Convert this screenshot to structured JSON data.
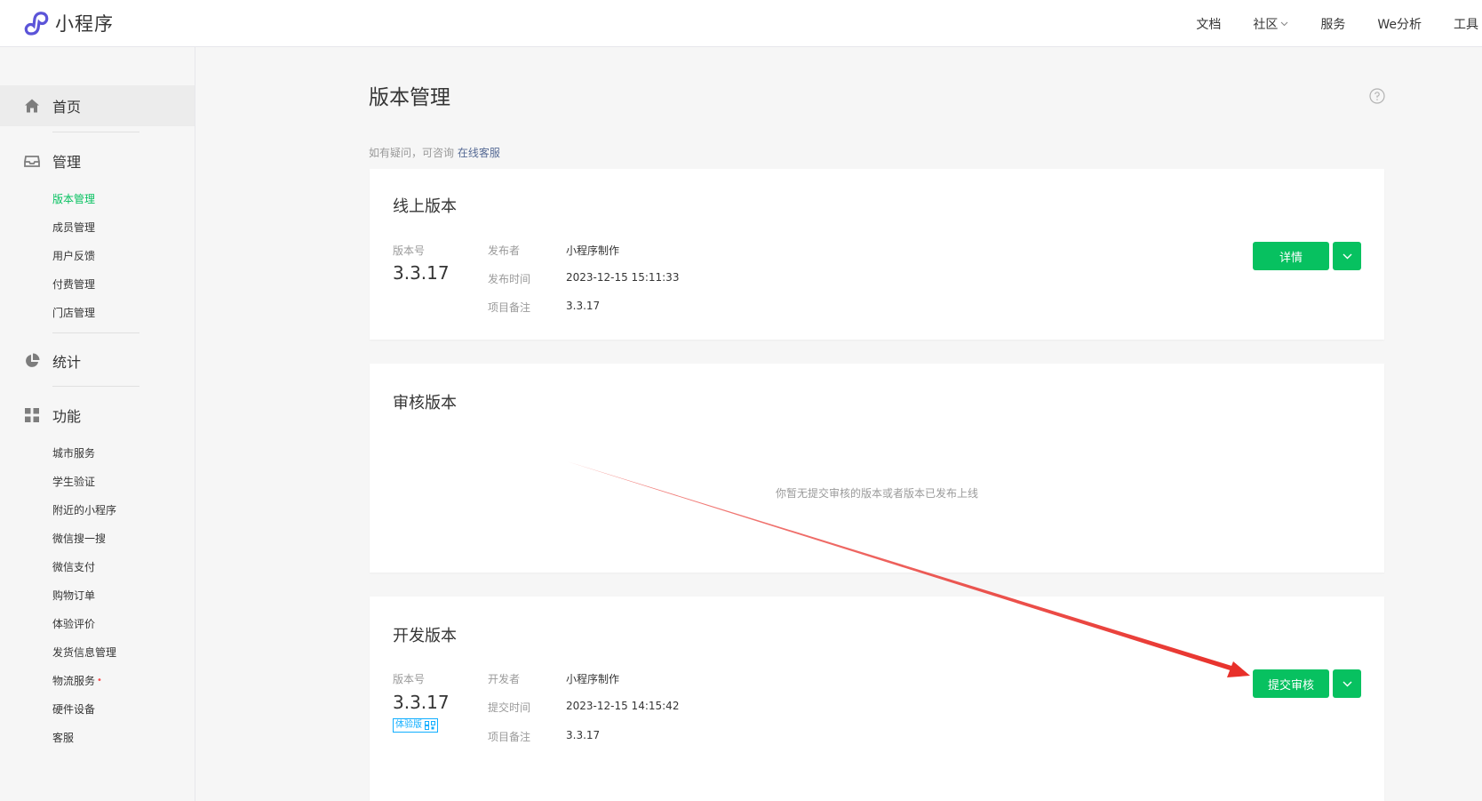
{
  "header": {
    "app_name": "小程序",
    "nav": [
      "文档",
      "社区",
      "服务",
      "We分析",
      "工具"
    ]
  },
  "sidebar": {
    "home": "首页",
    "groups": {
      "manage": {
        "label": "管理",
        "items": [
          "版本管理",
          "成员管理",
          "用户反馈",
          "付费管理",
          "门店管理"
        ]
      },
      "stats": {
        "label": "统计"
      },
      "features": {
        "label": "功能",
        "items": [
          "城市服务",
          "学生验证",
          "附近的小程序",
          "微信搜一搜",
          "微信支付",
          "购物订单",
          "体验评价",
          "发货信息管理",
          "物流服务",
          "硬件设备",
          "客服"
        ]
      }
    }
  },
  "main": {
    "title": "版本管理",
    "hint_text": "如有疑问，可咨询",
    "hint_link": "在线客服",
    "online": {
      "title": "线上版本",
      "version_label": "版本号",
      "version": "3.3.17",
      "publisher_label": "发布者",
      "publisher": "小程序制作",
      "time_label": "发布时间",
      "time": "2023-12-15 15:11:33",
      "note_label": "项目备注",
      "note": "3.3.17",
      "detail_button": "详情"
    },
    "review": {
      "title": "审核版本",
      "empty_tip": "你暂无提交审核的版本或者版本已发布上线"
    },
    "dev": {
      "title": "开发版本",
      "version_label": "版本号",
      "version": "3.3.17",
      "badge": "体验版",
      "developer_label": "开发者",
      "developer": "小程序制作",
      "time_label": "提交时间",
      "time": "2023-12-15 14:15:42",
      "note_label": "项目备注",
      "note": "3.3.17",
      "submit_button": "提交审核"
    }
  },
  "colors": {
    "accent_green": "#07c160",
    "link_blue": "#576b95",
    "arrow_red": "#e8302a",
    "badge_blue": "#10aeff"
  }
}
